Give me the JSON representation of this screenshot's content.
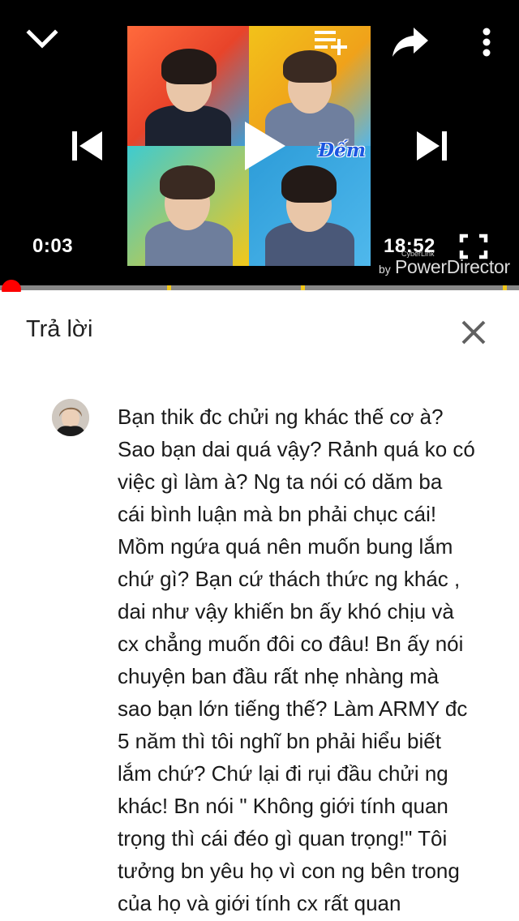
{
  "player": {
    "current_time": "0:03",
    "duration": "18:52",
    "overlay_word": "Đếm",
    "watermark": {
      "small": "CyberLink",
      "by": "by",
      "name": "PowerDirector"
    },
    "icons": {
      "collapse": "chevron-down-icon",
      "queue": "playlist-add-icon",
      "share": "share-icon",
      "more": "more-vert-icon",
      "previous": "skip-previous-icon",
      "play": "play-icon",
      "next": "skip-next-icon",
      "fullscreen": "fullscreen-icon"
    },
    "progress_fraction": 0.003,
    "colors": {
      "scrubber": "#ff0000",
      "track": "#888888",
      "marker": "#f2c81a"
    }
  },
  "reply": {
    "title": "Trả lời",
    "close_icon": "close-icon"
  },
  "comment": {
    "text": "Bạn thik đc chửi ng khác thế cơ à?\nSao bạn dai quá vậy? Rảnh quá ko có\nviệc gì làm à? Ng ta nói có dăm ba\ncái bình luận mà bn phải chục cái!\nMồm ngứa quá nên muốn bung lắm\nchứ gì? Bạn cứ thách thức ng khác ,\ndai như vậy khiến bn ấy khó chịu và\ncx chẳng muốn đôi co đâu! Bn ấy nói\nchuyện ban đầu rất nhẹ nhàng mà\nsao bạn lớn tiếng thế? Làm ARMY đc\n5 năm thì tôi nghĩ bn phải hiểu biết\nlắm chứ? Chứ lại đi rụi đầu chửi ng\nkhác! Bn nói \" Không giới tính quan\ntrọng thì cái đéo gì quan trọng!\" Tôi\ntưởng bn yêu họ vì con ng bên trong\ncủa họ và giới tính cx rất quan"
  }
}
